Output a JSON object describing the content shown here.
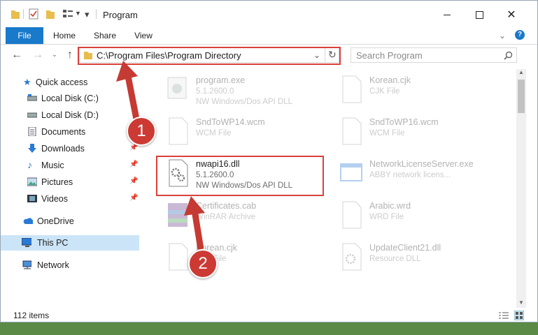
{
  "window": {
    "title": "Program"
  },
  "ribbon": {
    "tabs": [
      "File",
      "Home",
      "Share",
      "View"
    ]
  },
  "address": {
    "path": "C:\\Program Files\\Program Directory"
  },
  "search": {
    "placeholder": "Search Program"
  },
  "sidebar": {
    "items": [
      {
        "label": "Quick access",
        "icon": "star-icon",
        "pinned": false
      },
      {
        "label": "Local Disk (C:)",
        "icon": "drive-icon",
        "pinned": false
      },
      {
        "label": "Local Disk (D:)",
        "icon": "drive-icon",
        "pinned": false
      },
      {
        "label": "Documents",
        "icon": "documents-icon",
        "pinned": false
      },
      {
        "label": "Downloads",
        "icon": "download-icon",
        "pinned": true
      },
      {
        "label": "Music",
        "icon": "music-icon",
        "pinned": true
      },
      {
        "label": "Pictures",
        "icon": "pictures-icon",
        "pinned": true
      },
      {
        "label": "Videos",
        "icon": "videos-icon",
        "pinned": true
      },
      {
        "label": "OneDrive",
        "icon": "cloud-icon",
        "pinned": false
      },
      {
        "label": "This PC",
        "icon": "computer-icon",
        "pinned": false,
        "selected": true
      },
      {
        "label": "Network",
        "icon": "network-icon",
        "pinned": false
      }
    ]
  },
  "files": [
    {
      "name": "program.exe",
      "type": "5.1.2600.0",
      "desc": "NW Windows/Dos API DLL",
      "icon": "exe-icon"
    },
    {
      "name": "Korean.cjk",
      "type": "CJK File",
      "desc": "",
      "icon": "file-icon"
    },
    {
      "name": "SndToWP14.wcm",
      "type": "WCM File",
      "desc": "",
      "icon": "file-icon"
    },
    {
      "name": "SndToWP16.wcm",
      "type": "WCM File",
      "desc": "",
      "icon": "file-icon"
    },
    {
      "name": "nwapi16.dll",
      "type": "5.1.2600.0",
      "desc": "NW Windows/Dos API DLL",
      "icon": "dll-gear-icon"
    },
    {
      "name": "NetworkLicenseServer.exe",
      "type": "ABBY network licens...",
      "desc": "",
      "icon": "exe-window-icon"
    },
    {
      "name": "Certificates.cab",
      "type": "WinRAR Archive",
      "desc": "",
      "icon": "archive-icon"
    },
    {
      "name": "Arabic.wrd",
      "type": "WRD File",
      "desc": "",
      "icon": "file-icon"
    },
    {
      "name": "Korean.cjk",
      "type": "CJK File",
      "desc": "",
      "icon": "file-icon"
    },
    {
      "name": "UpdateClient21.dll",
      "type": "Resource DLL",
      "desc": "",
      "icon": "dll-gear-icon"
    }
  ],
  "status": {
    "items_count": "112 items"
  },
  "annotations": {
    "marker1": "1",
    "marker2": "2"
  },
  "colors": {
    "accent": "#1979ca",
    "highlight": "#d9413b"
  }
}
